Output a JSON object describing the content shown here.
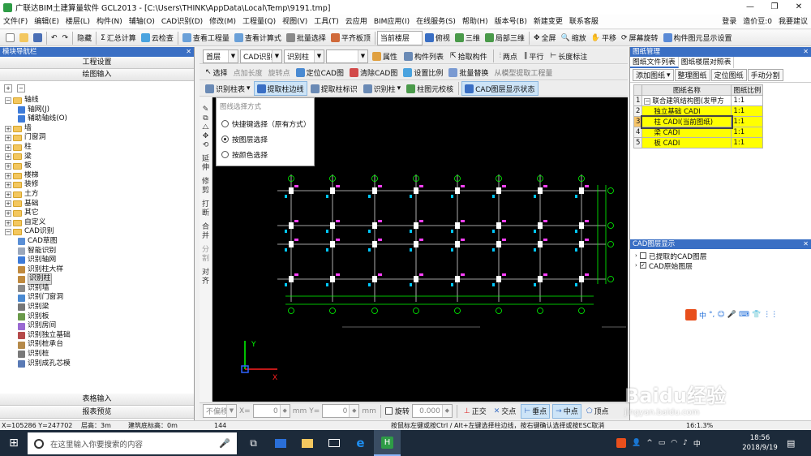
{
  "window": {
    "title": "广联达BIM土建算量软件 GCL2013 - [C:\\Users\\THINK\\AppData\\Local\\Temp\\9191.tmp]",
    "min": "—",
    "max": "❐",
    "close": "✕"
  },
  "menu": [
    "文件(F)",
    "编辑(E)",
    "楼层(L)",
    "构件(N)",
    "辅轴(O)",
    "CAD识别(D)",
    "修改(M)",
    "工程量(Q)",
    "视图(V)",
    "工具(T)",
    "云应用",
    "BIM应用(I)",
    "在线服务(S)",
    "帮助(H)",
    "版本号(B)",
    "新建变更",
    "联系客服"
  ],
  "menu_right": {
    "login": "登录",
    "coins": "造价豆:0",
    "feedback": "我要建议"
  },
  "toolbar1": [
    "隐藏",
    "汇总计算",
    "云检查",
    "查看工程量",
    "查看计算式",
    "批量选择",
    "平齐板顶",
    "当前楼层",
    "俯视",
    "三维",
    "局部三维",
    "全屏",
    "缩放",
    "平移",
    "屏幕旋转",
    "构件图元显示设置"
  ],
  "toolbar2": {
    "floor": "首层",
    "cad": "CAD识别",
    "type": "识别柱",
    "empty": "",
    "buttons": [
      "属性",
      "构件列表",
      "拾取构件",
      "两点",
      "平行",
      "长度标注"
    ]
  },
  "toolbar3": [
    "选择",
    "点加长度",
    "旋转点",
    "定位CAD图",
    "清除CAD图",
    "设置比例",
    "批量替换",
    "从模型提取工程量"
  ],
  "toolbar4": [
    "识别柱表",
    "提取柱边线",
    "提取柱标识",
    "识别柱",
    "柱图元校核",
    "CAD图层显示状态"
  ],
  "left_panel": {
    "header": "模块导航栏",
    "pin": "✕",
    "buttons": [
      "工程设置",
      "绘图输入"
    ],
    "tree": [
      {
        "label": "轴线",
        "level": 0,
        "exp": "−",
        "folder": true
      },
      {
        "label": "轴网(J)",
        "level": 1,
        "color": "#3d7bd9"
      },
      {
        "label": "辅助轴线(O)",
        "level": 1,
        "color": "#3d7bd9"
      },
      {
        "label": "墙",
        "level": 0,
        "exp": "+",
        "folder": true
      },
      {
        "label": "门窗洞",
        "level": 0,
        "exp": "+",
        "folder": true
      },
      {
        "label": "柱",
        "level": 0,
        "exp": "+",
        "folder": true
      },
      {
        "label": "梁",
        "level": 0,
        "exp": "+",
        "folder": true
      },
      {
        "label": "板",
        "level": 0,
        "exp": "+",
        "folder": true
      },
      {
        "label": "楼梯",
        "level": 0,
        "exp": "+",
        "folder": true
      },
      {
        "label": "装修",
        "level": 0,
        "exp": "+",
        "folder": true
      },
      {
        "label": "土方",
        "level": 0,
        "exp": "+",
        "folder": true
      },
      {
        "label": "基础",
        "level": 0,
        "exp": "+",
        "folder": true
      },
      {
        "label": "其它",
        "level": 0,
        "exp": "+",
        "folder": true
      },
      {
        "label": "自定义",
        "level": 0,
        "exp": "+",
        "folder": true
      },
      {
        "label": "CAD识别",
        "level": 0,
        "exp": "−",
        "folder": true
      },
      {
        "label": "CAD草图",
        "level": 1,
        "color": "#5a8fd6"
      },
      {
        "label": "智能识别",
        "level": 1,
        "color": "#9aa7bb"
      },
      {
        "label": "识别轴网",
        "level": 1,
        "color": "#3d7bd9"
      },
      {
        "label": "识别柱大样",
        "level": 1,
        "color": "#c08a3e"
      },
      {
        "label": "识别柱",
        "level": 1,
        "color": "#c08a3e",
        "sel": true
      },
      {
        "label": "识别墙",
        "level": 1,
        "color": "#8a8a8a"
      },
      {
        "label": "识别门窗洞",
        "level": 1,
        "color": "#4a8ad2"
      },
      {
        "label": "识别梁",
        "level": 1,
        "color": "#777777"
      },
      {
        "label": "识别板",
        "level": 1,
        "color": "#6a9a4a"
      },
      {
        "label": "识别房间",
        "level": 1,
        "color": "#9a6ad2"
      },
      {
        "label": "识别独立基础",
        "level": 1,
        "color": "#b54a4a"
      },
      {
        "label": "识别桩承台",
        "level": 1,
        "color": "#b58a4a"
      },
      {
        "label": "识别桩",
        "level": 1,
        "color": "#7a7a7a"
      },
      {
        "label": "识别成孔芯模",
        "level": 1,
        "color": "#5a7ab5"
      }
    ],
    "bottom_buttons": [
      "表格输入",
      "报表预览"
    ]
  },
  "vertical_tools": [
    "延伸",
    "修剪",
    "打断",
    "合并",
    "分割",
    "对齐"
  ],
  "popup": {
    "title": "图线选择方式",
    "options": [
      {
        "label": "快捷键选择（原有方式）",
        "checked": false
      },
      {
        "label": "按图层选择",
        "checked": true
      },
      {
        "label": "按颜色选择",
        "checked": false
      }
    ]
  },
  "right_panel": {
    "header": "图纸管理",
    "tabs": [
      "图纸文件列表",
      "图纸楼层对照表"
    ],
    "actions": [
      "添加图纸",
      "整理图纸",
      "定位图纸",
      "手动分割"
    ],
    "columns": [
      "图纸名称",
      "图纸比例"
    ],
    "rows": [
      {
        "num": "1",
        "exp": "−",
        "name": "联合建筑结构图(发甲方",
        "scale": "1:1",
        "highlight": false
      },
      {
        "num": "2",
        "exp": "",
        "name": "独立基础 CADI",
        "scale": "1:1",
        "highlight": true
      },
      {
        "num": "3",
        "exp": "",
        "name": "柱 CADI(当前图纸)",
        "scale": "1:1",
        "highlight": true,
        "current": true
      },
      {
        "num": "4",
        "exp": "",
        "name": "梁 CADI",
        "scale": "1:1",
        "highlight": true
      },
      {
        "num": "5",
        "exp": "",
        "name": "板 CADI",
        "scale": "1:1",
        "highlight": true
      }
    ]
  },
  "layer_panel": {
    "header": "CAD图层显示",
    "items": [
      {
        "label": "已提取的CAD图层",
        "checked": false
      },
      {
        "label": "CAD原始图层",
        "checked": true
      }
    ]
  },
  "axes": {
    "y": "Y",
    "x": "X"
  },
  "snap_bar": {
    "mode": "不偏移",
    "x_label": "X=",
    "x_val": "0",
    "mm1": "mm",
    "y_label": "Y=",
    "y_val": "0",
    "mm2": "mm",
    "rotate_label": "旋转",
    "rotate_val": "0.000",
    "snaps": [
      "正交",
      "交点",
      "垂点",
      "中点",
      "顶点"
    ]
  },
  "status": {
    "coords": "X=105286  Y=247702",
    "floor_height": "层高：3m",
    "base_elev": "建筑底标高：0m",
    "count": "144",
    "hint": "按鼠标左键或按Ctrl / Alt+左键选择柱边线，按右键确认选择或按ESC取消",
    "scale": "16:1.3%"
  },
  "ime_bar": [
    "中",
    "°,",
    "☺",
    "🎤",
    "⌨",
    "👕",
    "⋮⋮"
  ],
  "taskbar": {
    "search_placeholder": "在这里输入你要搜索的内容",
    "time": "18:56",
    "date": "2018/9/19",
    "lang": "中"
  },
  "watermark": {
    "text": "Baidu经验",
    "url": "jingyan.baidu.com"
  },
  "colors": {
    "accent": "#3a6fc4",
    "highlight": "#ffff00",
    "canvas": "#000000"
  }
}
